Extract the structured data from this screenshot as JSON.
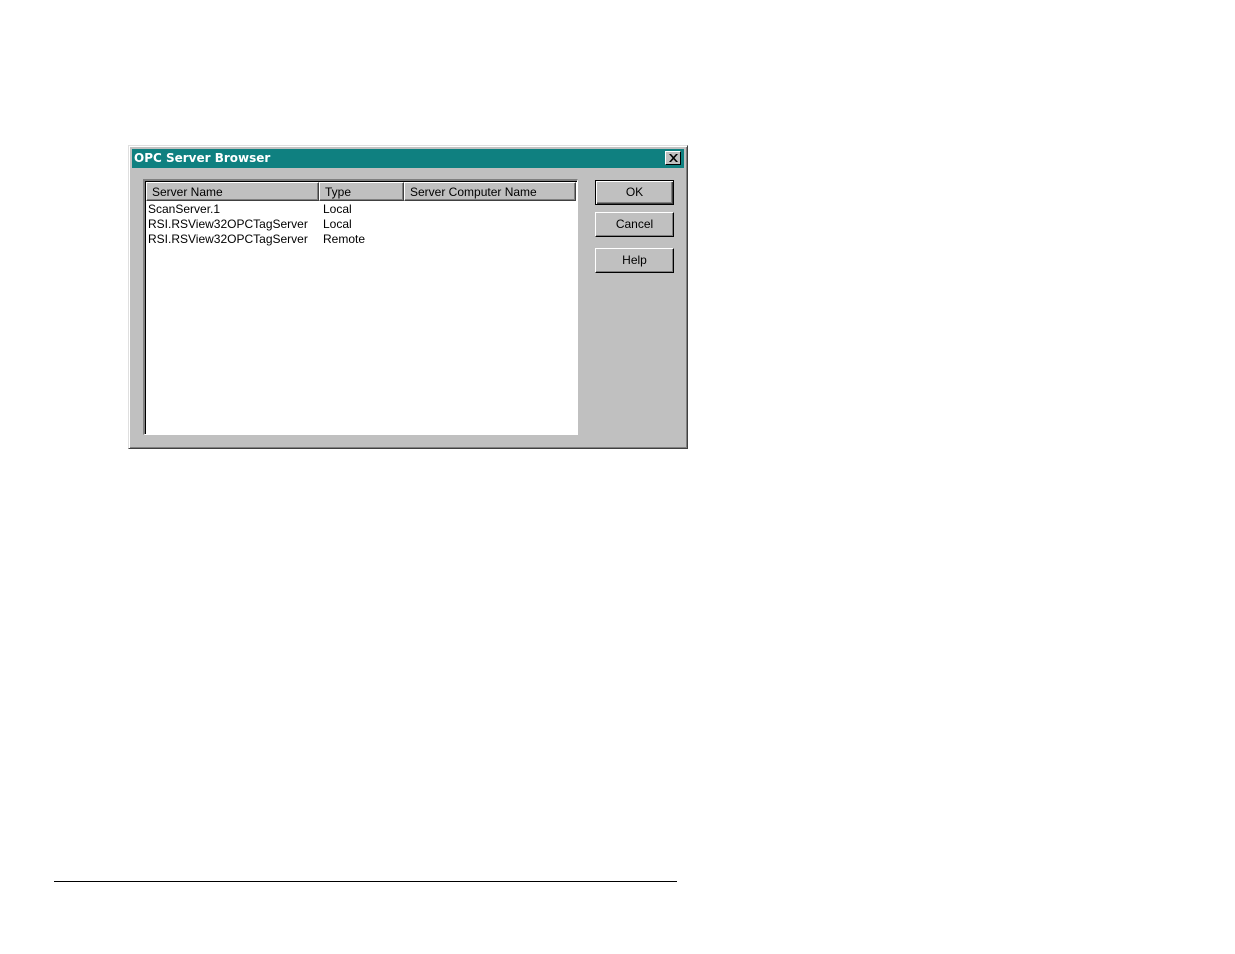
{
  "dialog": {
    "title": "OPC Server Browser",
    "close_icon": "close-x-icon"
  },
  "list": {
    "columns": [
      "Server Name",
      "Type",
      "Server Computer Name"
    ],
    "rows": [
      {
        "server_name": "ScanServer.1",
        "type": "Local",
        "computer_name": ""
      },
      {
        "server_name": "RSI.RSView32OPCTagServer",
        "type": "Local",
        "computer_name": ""
      },
      {
        "server_name": "RSI.RSView32OPCTagServer",
        "type": "Remote",
        "computer_name": ""
      }
    ]
  },
  "buttons": {
    "ok_label": "OK",
    "cancel_label": "Cancel",
    "help_label": "Help"
  },
  "colors": {
    "titlebar": "#0f8080",
    "face": "#c0c0c0"
  }
}
